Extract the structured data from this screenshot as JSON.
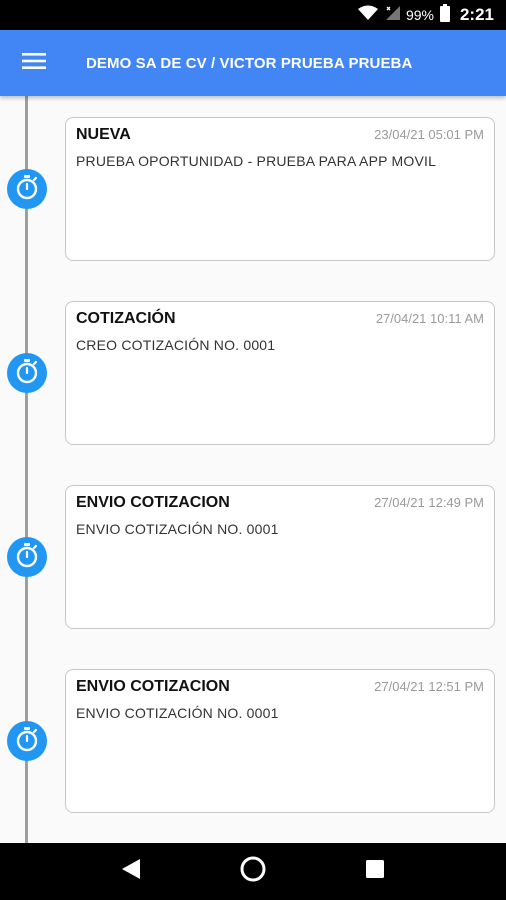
{
  "status_bar": {
    "battery": "99%",
    "time": "2:21"
  },
  "header": {
    "title": "DEMO SA DE CV / VICTOR PRUEBA PRUEBA",
    "accent": "#4285f4"
  },
  "events": [
    {
      "title": "NUEVA",
      "date": "23/04/21 05:01 PM",
      "description": "PRUEBA OPORTUNIDAD - PRUEBA PARA APP MOVIL",
      "icon": "stopwatch-icon"
    },
    {
      "title": "COTIZACIÓN",
      "date": "27/04/21 10:11 AM",
      "description": "CREO COTIZACIÓN NO. 0001",
      "icon": "stopwatch-icon"
    },
    {
      "title": "ENVIO COTIZACION",
      "date": "27/04/21 12:49 PM",
      "description": "ENVIO COTIZACIÓN NO. 0001",
      "icon": "stopwatch-icon"
    },
    {
      "title": "ENVIO COTIZACION",
      "date": "27/04/21 12:51 PM",
      "description": "ENVIO COTIZACIÓN NO. 0001",
      "icon": "stopwatch-icon"
    }
  ],
  "nav": {
    "back_icon": "back-icon",
    "home_icon": "home-icon",
    "recents_icon": "recents-icon"
  }
}
